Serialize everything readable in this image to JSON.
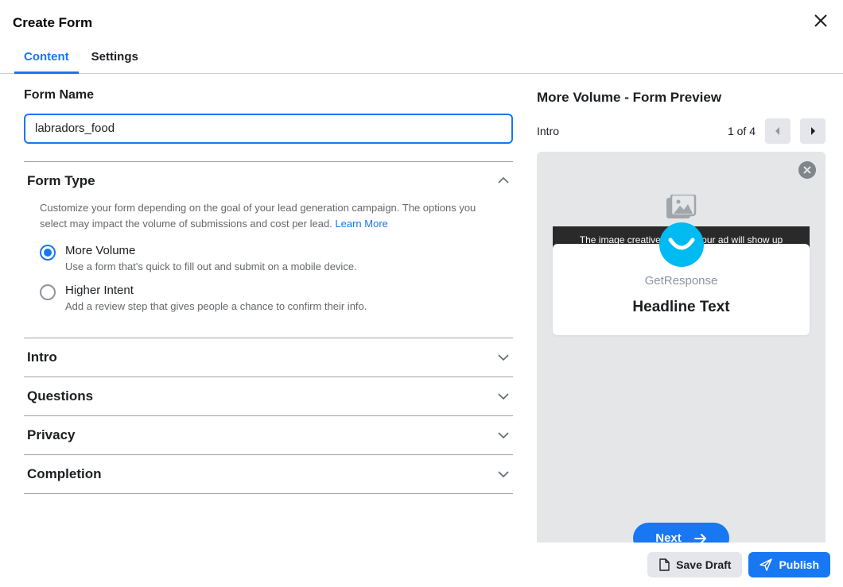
{
  "header": {
    "title": "Create Form"
  },
  "tabs": {
    "content": "Content",
    "settings": "Settings"
  },
  "formName": {
    "label": "Form Name",
    "value": "labradors_food"
  },
  "formType": {
    "title": "Form Type",
    "description": "Customize your form depending on the goal of your lead generation campaign. The options you select may impact the volume of submissions and cost per lead. ",
    "learnMore": "Learn More",
    "options": {
      "moreVolume": {
        "label": "More Volume",
        "desc": "Use a form that's quick to fill out and submit on a mobile device."
      },
      "higherIntent": {
        "label": "Higher Intent",
        "desc": "Add a review step that gives people a chance to confirm their info."
      }
    }
  },
  "sections": {
    "intro": "Intro",
    "questions": "Questions",
    "privacy": "Privacy",
    "completion": "Completion"
  },
  "preview": {
    "title": "More Volume - Form Preview",
    "pageLabel": "Intro",
    "pageCount": "1 of 4",
    "adText": "The image creative used in your ad will show up",
    "brandName": "GetResponse",
    "headline": "Headline Text",
    "nextButton": "Next"
  },
  "footer": {
    "saveDraft": "Save Draft",
    "publish": "Publish"
  }
}
